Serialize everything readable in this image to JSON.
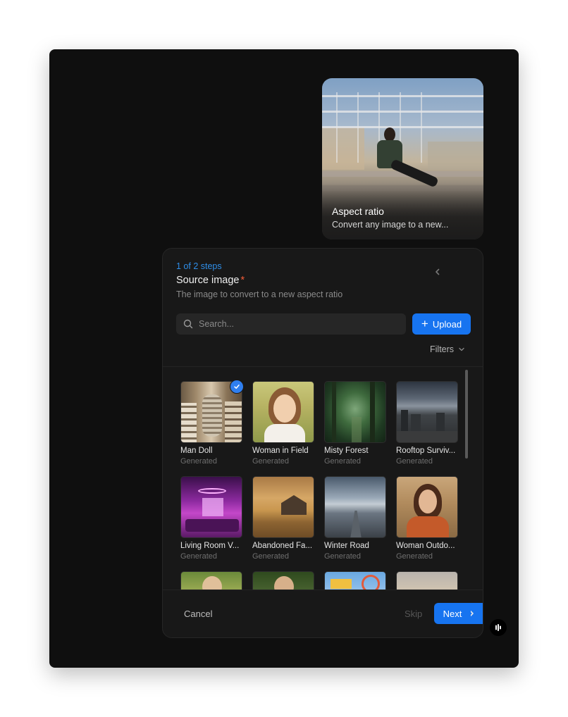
{
  "preview": {
    "title": "Aspect ratio",
    "subtitle": "Convert any image to a new..."
  },
  "dialog": {
    "steps": "1 of 2 steps",
    "title": "Source image",
    "required_mark": "*",
    "subtitle": "The image to convert to a new aspect ratio",
    "search_placeholder": "Search...",
    "upload_label": "Upload",
    "filters_label": "Filters",
    "cancel_label": "Cancel",
    "skip_label": "Skip",
    "next_label": "Next"
  },
  "images": [
    {
      "name": "Man Doll",
      "meta": "Generated",
      "selected": true
    },
    {
      "name": "Woman in Field",
      "meta": "Generated"
    },
    {
      "name": "Misty Forest",
      "meta": "Generated"
    },
    {
      "name": "Rooftop Surviv...",
      "meta": "Generated"
    },
    {
      "name": "Living Room V...",
      "meta": "Generated"
    },
    {
      "name": "Abandoned Fa...",
      "meta": "Generated"
    },
    {
      "name": "Winter Road",
      "meta": "Generated"
    },
    {
      "name": "Woman Outdo...",
      "meta": "Generated"
    },
    {
      "name": "",
      "meta": ""
    },
    {
      "name": "",
      "meta": ""
    },
    {
      "name": "",
      "meta": ""
    },
    {
      "name": "",
      "meta": ""
    }
  ],
  "colors": {
    "accent": "#1774f0",
    "steps": "#2f8ee8",
    "required": "#f25c38",
    "background": "#0f0f0f",
    "dialog": "#181818"
  }
}
